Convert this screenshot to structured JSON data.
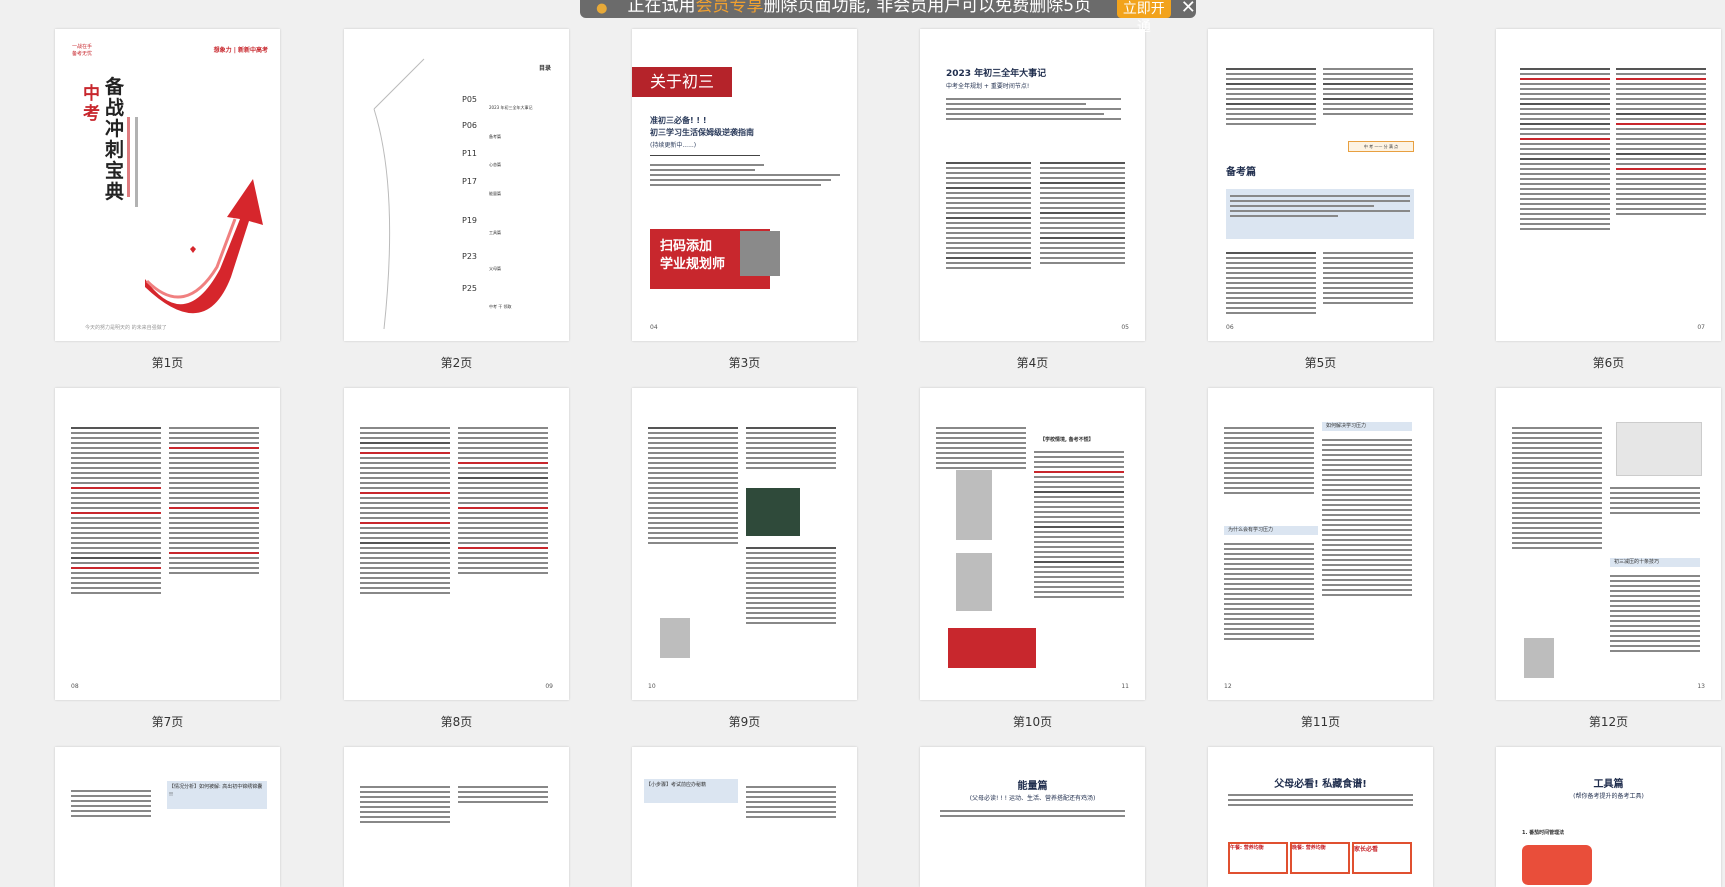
{
  "banner": {
    "text_before": "正在试用",
    "highlight": "会员专享",
    "text_after": "删除页面功能, 非会员用户可以免费删除5页",
    "button_label": "立即开通",
    "accent": "#f2a31c"
  },
  "pages": [
    {
      "label": "第1页"
    },
    {
      "label": "第2页"
    },
    {
      "label": "第3页"
    },
    {
      "label": "第4页"
    },
    {
      "label": "第5页"
    },
    {
      "label": "第6页"
    },
    {
      "label": "第7页"
    },
    {
      "label": "第8页"
    },
    {
      "label": "第9页"
    },
    {
      "label": "第10页"
    },
    {
      "label": "第11页"
    },
    {
      "label": "第12页"
    }
  ],
  "p1": {
    "top_left": "一战在手\n备考无忧",
    "brand": "想象力 | 新新中高考",
    "title_red": "中考",
    "title_black": "备战冲刺宝典",
    "footer": "今天的努力是明天的 的未来自强做了"
  },
  "p2": {
    "heading": "目录",
    "toc": [
      {
        "num": "P05",
        "text": "2023 年初三全年大事记"
      },
      {
        "num": "P06",
        "text": "备考篇"
      },
      {
        "num": "P11",
        "text": "心态篇"
      },
      {
        "num": "P17",
        "text": "能量篇"
      },
      {
        "num": "P19",
        "text": "工具篇"
      },
      {
        "num": "P23",
        "text": "父母篇"
      },
      {
        "num": "P25",
        "text": "中考 干 领取"
      }
    ]
  },
  "p3": {
    "header": "关于初三",
    "subtitle1": "准初三必备! ! !",
    "subtitle2": "初三学习生活保姆级逆袭指南",
    "subtitle3": "(持续更新中......)",
    "qr_title1": "扫码添加",
    "qr_title2": "学业规划师",
    "page_num": "04"
  },
  "p4": {
    "title": "2023 年初三全年大事记",
    "subtitle": "中考全年规划 + 重要时间节点!",
    "page_num": "05"
  },
  "p5": {
    "section": "备考篇",
    "bar_text": "中 考 —— 分 满 点",
    "page_num": "06"
  },
  "p6": {
    "page_num": "07"
  },
  "p7": {
    "page_num": "08"
  },
  "p8": {
    "page_num": "09"
  },
  "p9": {
    "page_num": "10"
  },
  "p10": {
    "heading": "【学校情境, 备考不慌】",
    "page_num": "11"
  },
  "p11": {
    "heading1": "如何解决学习压力",
    "heading2": "为什么会有学习压力",
    "page_num": "12"
  },
  "p12": {
    "heading": "初三减压的十条技巧",
    "page_num": "13"
  },
  "row3": {
    "p13_heading": "【情况分析】如何被解: 高出初中锦绣锦囊 !!",
    "p15_heading": "【小步骤】考试前应办秘籍",
    "p16_title": "能量篇",
    "p16_sub": "(父母必读! ! ! 运动、生活、营养搭配还有鸡汤)",
    "p17_title": "父母必看! 私藏食谱!",
    "p17_labels": [
      "午餐: 营养均衡",
      "晚餐: 营养均衡",
      "家长必看"
    ],
    "p18_title": "工具篇",
    "p18_sub": "(帮你备考提升的备考工具)",
    "p18_item": "1. 番茄时间管理法"
  }
}
